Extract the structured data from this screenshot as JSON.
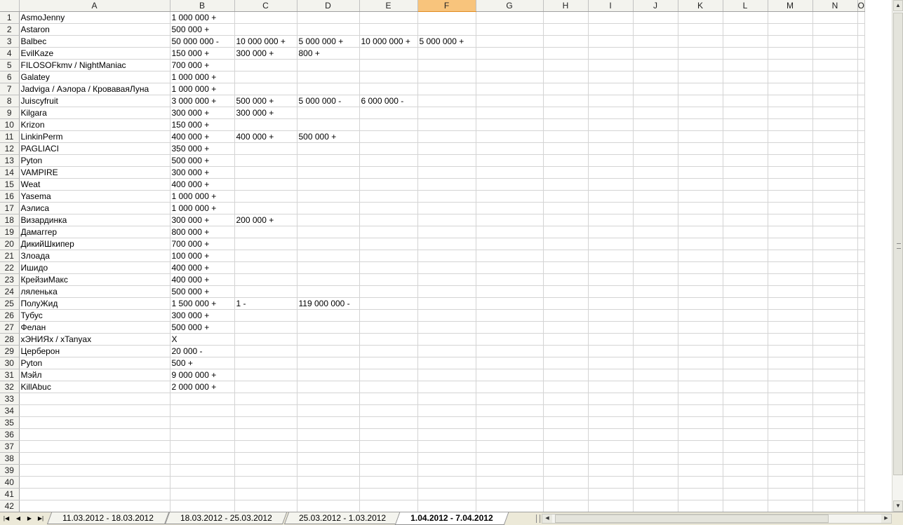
{
  "columns": [
    "A",
    "B",
    "C",
    "D",
    "E",
    "F",
    "G",
    "H",
    "I",
    "J",
    "K",
    "L",
    "M",
    "N",
    "O"
  ],
  "selected_column": "F",
  "rows": [
    {
      "n": "1",
      "c": [
        "AsmoJenny",
        "1 000 000 +",
        "",
        "",
        "",
        ""
      ]
    },
    {
      "n": "2",
      "c": [
        "Astaron",
        "500 000 +",
        "",
        "",
        "",
        ""
      ]
    },
    {
      "n": "3",
      "c": [
        "Balbec",
        "50 000 000 -",
        "10 000 000 +",
        "5 000 000 +",
        "10 000 000 +",
        "5 000 000 +"
      ]
    },
    {
      "n": "4",
      "c": [
        "EvilKaze",
        "150 000 +",
        "300 000 +",
        "800 +",
        "",
        ""
      ]
    },
    {
      "n": "5",
      "c": [
        "FILOSOFkmv / NightManiac",
        "700 000 +",
        "",
        "",
        "",
        ""
      ]
    },
    {
      "n": "6",
      "c": [
        "Galatey",
        "1 000 000 +",
        "",
        "",
        "",
        ""
      ]
    },
    {
      "n": "7",
      "c": [
        "Jadviga / Аэлора / КроваваяЛуна",
        "1 000 000 +",
        "",
        "",
        "",
        ""
      ]
    },
    {
      "n": "8",
      "c": [
        "Juiscyfruit",
        "3 000 000 +",
        "500 000 +",
        "5 000 000 -",
        "6 000 000 -",
        ""
      ]
    },
    {
      "n": "9",
      "c": [
        "Kilgara",
        "300 000 +",
        "300 000 +",
        "",
        "",
        ""
      ]
    },
    {
      "n": "10",
      "c": [
        "Krizon",
        "150 000 +",
        "",
        "",
        "",
        ""
      ]
    },
    {
      "n": "11",
      "c": [
        "LinkinPerm",
        "400 000 +",
        "400 000 +",
        "500 000 +",
        "",
        ""
      ]
    },
    {
      "n": "12",
      "c": [
        "PAGLIACI",
        "350 000 +",
        "",
        "",
        "",
        ""
      ]
    },
    {
      "n": "13",
      "c": [
        "Pyton",
        "500 000 +",
        "",
        "",
        "",
        ""
      ]
    },
    {
      "n": "14",
      "c": [
        "VAMPIRE",
        "300 000 +",
        "",
        "",
        "",
        ""
      ]
    },
    {
      "n": "15",
      "c": [
        "Weat",
        "400 000 +",
        "",
        "",
        "",
        ""
      ]
    },
    {
      "n": "16",
      "c": [
        "Yasema",
        "1 000 000 +",
        "",
        "",
        "",
        ""
      ]
    },
    {
      "n": "17",
      "c": [
        "Аэлиса",
        "1 000 000 +",
        "",
        "",
        "",
        ""
      ]
    },
    {
      "n": "18",
      "c": [
        "Визардинка",
        "300 000 +",
        "200 000 +",
        "",
        "",
        ""
      ]
    },
    {
      "n": "19",
      "c": [
        "Дамаггер",
        "800 000 +",
        "",
        "",
        "",
        ""
      ]
    },
    {
      "n": "20",
      "c": [
        "ДикийШкипер",
        "700 000 +",
        "",
        "",
        "",
        ""
      ]
    },
    {
      "n": "21",
      "c": [
        "Злоада",
        "100 000 +",
        "",
        "",
        "",
        ""
      ]
    },
    {
      "n": "22",
      "c": [
        "Ишидо",
        "400 000 +",
        "",
        "",
        "",
        ""
      ]
    },
    {
      "n": "23",
      "c": [
        "КрейзиМакс",
        "400 000 +",
        "",
        "",
        "",
        ""
      ]
    },
    {
      "n": "24",
      "c": [
        "ляленька",
        "500 000 +",
        "",
        "",
        "",
        ""
      ]
    },
    {
      "n": "25",
      "c": [
        "ПолуЖид",
        "1 500 000 +",
        "1 -",
        "119 000 000 -",
        "",
        ""
      ]
    },
    {
      "n": "26",
      "c": [
        "Тубус",
        "300 000 +",
        "",
        "",
        "",
        ""
      ]
    },
    {
      "n": "27",
      "c": [
        "Фелан",
        "500 000 +",
        "",
        "",
        "",
        ""
      ]
    },
    {
      "n": "28",
      "c": [
        "хЭНИЯх / хTanyax",
        "Х",
        "",
        "",
        "",
        ""
      ]
    },
    {
      "n": "29",
      "c": [
        "Церберон",
        "20 000 -",
        "",
        "",
        "",
        ""
      ]
    },
    {
      "n": "30",
      "c": [
        "Pyton",
        "500 +",
        "",
        "",
        "",
        ""
      ]
    },
    {
      "n": "31",
      "c": [
        "Мэйл",
        "9 000 000 +",
        "",
        "",
        "",
        ""
      ]
    },
    {
      "n": "32",
      "c": [
        "KillAbuc",
        "2 000 000 +",
        "",
        "",
        "",
        ""
      ]
    },
    {
      "n": "33",
      "c": []
    },
    {
      "n": "34",
      "c": []
    },
    {
      "n": "35",
      "c": []
    },
    {
      "n": "36",
      "c": []
    },
    {
      "n": "37",
      "c": []
    },
    {
      "n": "38",
      "c": []
    },
    {
      "n": "39",
      "c": []
    },
    {
      "n": "40",
      "c": []
    },
    {
      "n": "41",
      "c": []
    },
    {
      "n": "42",
      "c": []
    }
  ],
  "sheet_tabs": [
    {
      "label": "11.03.2012 - 18.03.2012",
      "active": false
    },
    {
      "label": "18.03.2012 - 25.03.2012",
      "active": false
    },
    {
      "label": "25.03.2012 - 1.03.2012",
      "active": false
    },
    {
      "label": "1.04.2012 - 7.04.2012",
      "active": true
    }
  ],
  "nav_buttons": [
    "first-sheet",
    "prev-sheet",
    "next-sheet",
    "last-sheet"
  ],
  "colors": {
    "header_bg": "#f3f3ee",
    "selected_header": "#f8c47c",
    "grid_line": "#d4d4d4"
  }
}
